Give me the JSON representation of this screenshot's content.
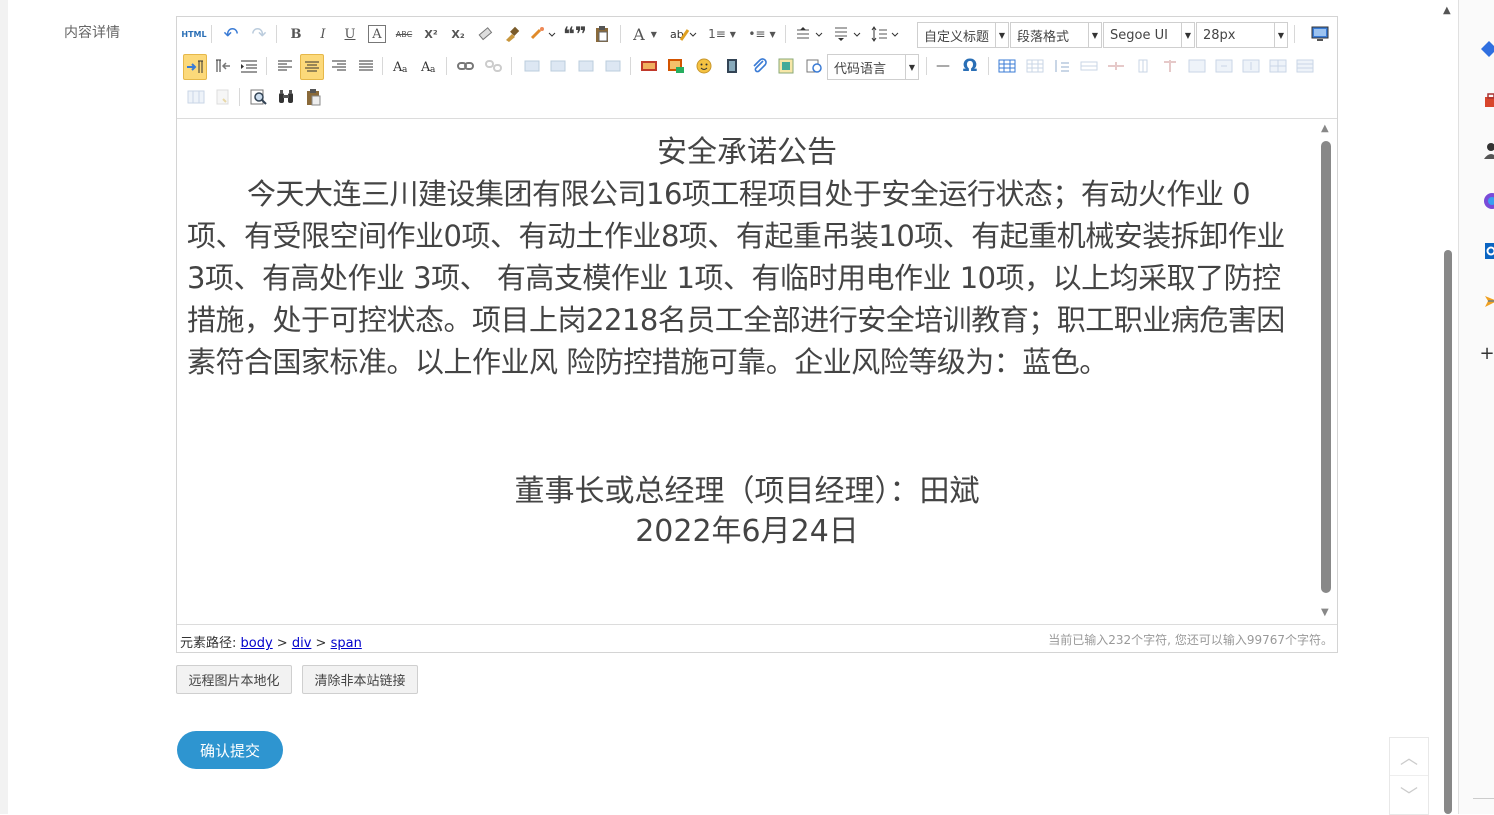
{
  "form": {
    "field_label": "内容详情"
  },
  "toolbar": {
    "html_label": "HTML",
    "undo": "↶",
    "redo": "↷",
    "bold": "B",
    "italic": "I",
    "underline": "U",
    "fontborder": "A",
    "strike": "ABC",
    "sup": "X²",
    "sub": "X₂",
    "quote": "❝❞",
    "fontcolor": "A",
    "ordered": "1≡",
    "unordered": "•≡",
    "heading_select": "自定义标题",
    "paragraph_select": "段落格式",
    "font_select": "Segoe UI",
    "size_select": "28px",
    "code_select": "代码语言",
    "hr": "—",
    "omega": "Ω"
  },
  "document": {
    "title": "安全承诺公告",
    "body": "今天大连三川建设集团有限公司16项工程项目处于安全运行状态；有动火作业 0项、有受限空间作业0项、有动土作业8项、有起重吊装10项、有起重机械安装拆卸作业3项、有高处作业 3项、 有高支模作业 1项、有临时用电作业 10项，以上均采取了防控措施，处于可控状态。项目上岗2218名员工全部进行安全培训教育；职工职业病危害因素符合国家标准。以上作业风 险防控措施可靠。企业风险等级为：蓝色。",
    "signature": "董事长或总经理（项目经理）：田斌",
    "date": "2022年6月24日"
  },
  "statusbar": {
    "path_label": "元素路径: ",
    "path": [
      "body",
      "div",
      "span"
    ],
    "separator": " > ",
    "count": "当前已输入232个字符, 您还可以输入99767个字符。"
  },
  "buttons": {
    "localize_images": "远程图片本地化",
    "clear_links": "清除非本站链接",
    "submit": "确认提交"
  },
  "colors": {
    "accent": "#2e95d0",
    "active_tool": "#fcd97a"
  }
}
